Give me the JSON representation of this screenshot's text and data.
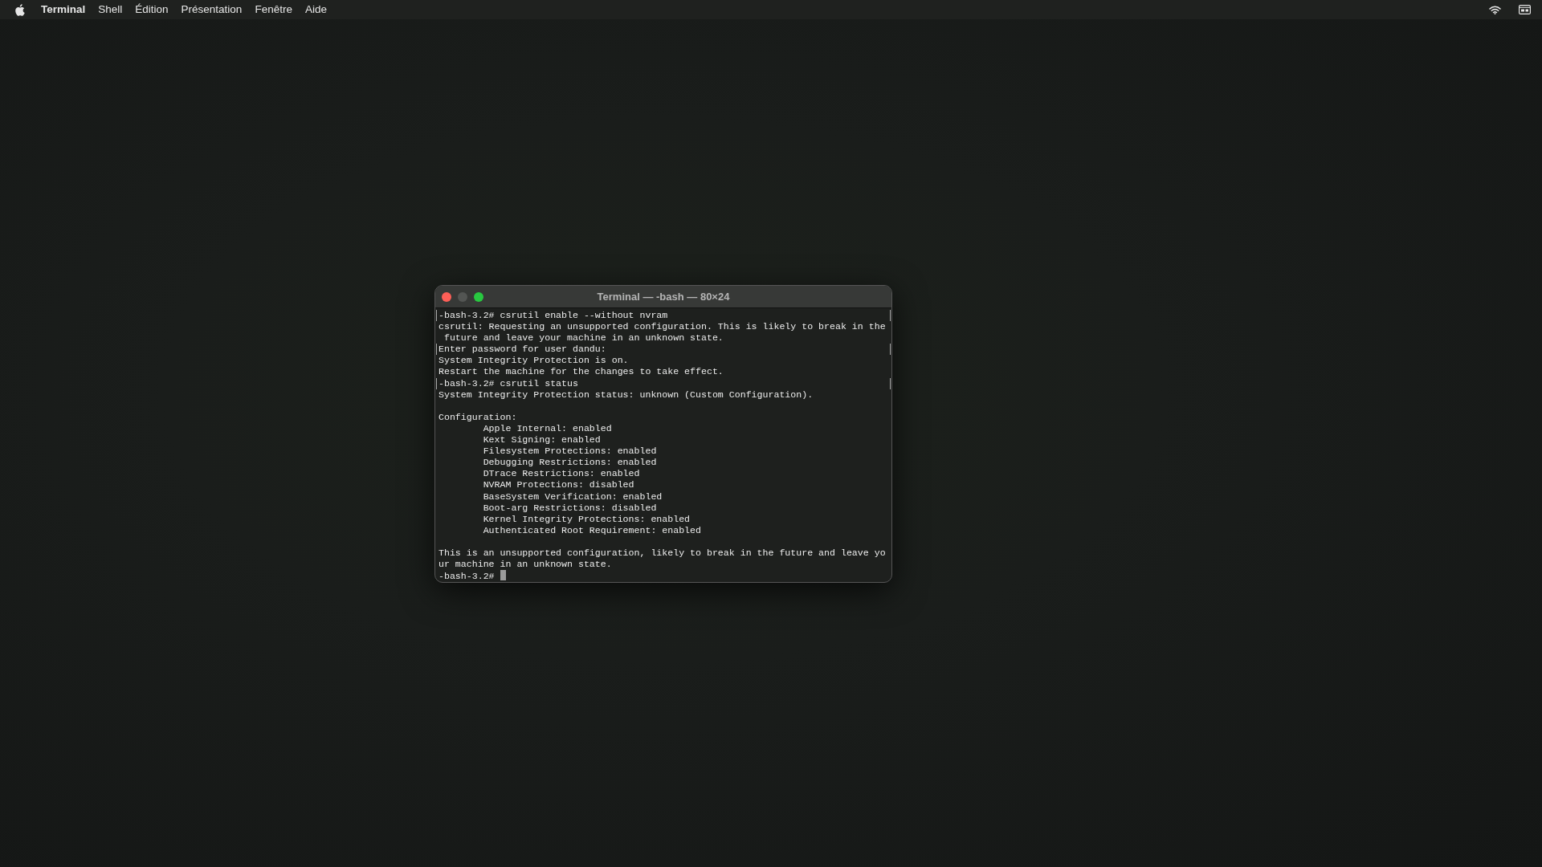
{
  "menu_bar": {
    "items": [
      {
        "label": "Terminal",
        "selected": true
      },
      {
        "label": "Shell",
        "selected": false
      },
      {
        "label": "Édition",
        "selected": false
      },
      {
        "label": "Présentation",
        "selected": false
      },
      {
        "label": "Fenêtre",
        "selected": false
      },
      {
        "label": "Aide",
        "selected": false
      }
    ]
  },
  "window": {
    "title": "Terminal — -bash — 80×24",
    "lines": [
      {
        "kind": "text",
        "text": "-bash-3.2# csrutil enable --without nvram",
        "marked": true,
        "cursor": false
      },
      {
        "kind": "text",
        "text": "csrutil: Requesting an unsupported configuration. This is likely to break in the",
        "marked": false,
        "cursor": false
      },
      {
        "kind": "text",
        "text": " future and leave your machine in an unknown state.",
        "marked": false,
        "cursor": false
      },
      {
        "kind": "text",
        "text": "Enter password for user dandu:",
        "marked": true,
        "cursor": false
      },
      {
        "kind": "text",
        "text": "System Integrity Protection is on.",
        "marked": false,
        "cursor": false
      },
      {
        "kind": "text",
        "text": "Restart the machine for the changes to take effect.",
        "marked": false,
        "cursor": false
      },
      {
        "kind": "text",
        "text": "-bash-3.2# csrutil status",
        "marked": true,
        "cursor": false
      },
      {
        "kind": "text",
        "text": "System Integrity Protection status: unknown (Custom Configuration).",
        "marked": false,
        "cursor": false
      },
      {
        "kind": "blank"
      },
      {
        "kind": "text",
        "text": "Configuration:",
        "marked": false,
        "cursor": false
      },
      {
        "kind": "text",
        "text": "        Apple Internal: enabled",
        "marked": false,
        "cursor": false
      },
      {
        "kind": "text",
        "text": "        Kext Signing: enabled",
        "marked": false,
        "cursor": false
      },
      {
        "kind": "text",
        "text": "        Filesystem Protections: enabled",
        "marked": false,
        "cursor": false
      },
      {
        "kind": "text",
        "text": "        Debugging Restrictions: enabled",
        "marked": false,
        "cursor": false
      },
      {
        "kind": "text",
        "text": "        DTrace Restrictions: enabled",
        "marked": false,
        "cursor": false
      },
      {
        "kind": "text",
        "text": "        NVRAM Protections: disabled",
        "marked": false,
        "cursor": false
      },
      {
        "kind": "text",
        "text": "        BaseSystem Verification: enabled",
        "marked": false,
        "cursor": false
      },
      {
        "kind": "text",
        "text": "        Boot-arg Restrictions: disabled",
        "marked": false,
        "cursor": false
      },
      {
        "kind": "text",
        "text": "        Kernel Integrity Protections: enabled",
        "marked": false,
        "cursor": false
      },
      {
        "kind": "text",
        "text": "        Authenticated Root Requirement: enabled",
        "marked": false,
        "cursor": false
      },
      {
        "kind": "blank"
      },
      {
        "kind": "text",
        "text": "This is an unsupported configuration, likely to break in the future and leave yo",
        "marked": false,
        "cursor": false
      },
      {
        "kind": "text",
        "text": "ur machine in an unknown state.",
        "marked": false,
        "cursor": false
      },
      {
        "kind": "text",
        "text": "-bash-3.2# ",
        "marked": false,
        "cursor": true
      }
    ]
  }
}
